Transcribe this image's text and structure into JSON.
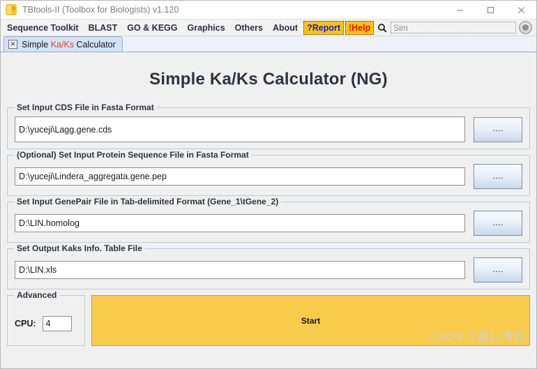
{
  "window": {
    "title": "TBtools-II (Toolbox for Biologists) v1.120",
    "app_icon": "tbtools-logo-icon",
    "controls": {
      "minimize": "minimize-icon",
      "maximize": "maximize-icon",
      "close": "close-icon"
    }
  },
  "menubar": {
    "items": [
      {
        "label": "Sequence Toolkit",
        "style": "plain"
      },
      {
        "label": "BLAST",
        "style": "plain"
      },
      {
        "label": "GO & KEGG",
        "style": "plain"
      },
      {
        "label": "Graphics",
        "style": "plain"
      },
      {
        "label": "Others",
        "style": "plain"
      },
      {
        "label": "About",
        "style": "plain"
      },
      {
        "label": "?Report",
        "style": "flag-report"
      },
      {
        "label": "!Help",
        "style": "flag-help"
      }
    ],
    "search": {
      "icon": "search-icon",
      "value": "Sim",
      "placeholder": "Sim",
      "go_button": "search-go-button"
    },
    "colors": {
      "flag_background": "#ffc20e",
      "report_text": "#0a22e0",
      "help_text": "#e01010"
    }
  },
  "tabs": [
    {
      "close_glyph": "✕",
      "label_pre": "Simple ",
      "label_accent": "Ka/Ks",
      "label_post": " Calculator",
      "accent_color": "#e8432a",
      "active": true
    }
  ],
  "main": {
    "page_title": "Simple Ka/Ks Calculator (NG)",
    "groups": [
      {
        "legend": "Set Input CDS File in Fasta Format",
        "value": "D:\\yuceji\\Lagg.gene.cds",
        "browse_label": "....",
        "tall": true
      },
      {
        "legend": "(Optional) Set Input Protein Sequence File in Fasta Format",
        "value": "D:\\yuceji\\Lindera_aggregata.gene.pep",
        "browse_label": "....",
        "tall": false
      },
      {
        "legend": "Set Input GenePair File in Tab-delimited Format (Gene_1\\tGene_2)",
        "value": "D:\\LIN.homolog",
        "browse_label": "....",
        "tall": false
      },
      {
        "legend": "Set Output Kaks Info. Table File",
        "value": "D:\\LIN.xls",
        "browse_label": "....",
        "tall": false
      }
    ],
    "advanced": {
      "legend": "Advanced",
      "cpu_label": "CPU:",
      "cpu_value": "4"
    },
    "start_button": {
      "label": "Start",
      "color": "#f8cb4c"
    },
    "watermark": "CSDN @星石传说"
  }
}
